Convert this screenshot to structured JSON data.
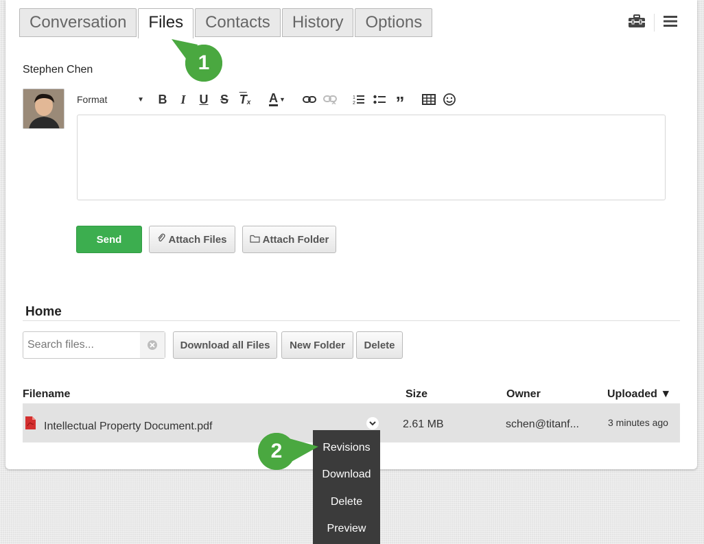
{
  "tabs": [
    {
      "label": "Conversation",
      "active": false
    },
    {
      "label": "Files",
      "active": true
    },
    {
      "label": "Contacts",
      "active": false
    },
    {
      "label": "History",
      "active": false
    },
    {
      "label": "Options",
      "active": false
    }
  ],
  "top_icons": [
    "toolbox-icon",
    "menu-icon"
  ],
  "user": {
    "name": "Stephen Chen"
  },
  "editor_toolbar": {
    "format_label": "Format",
    "buttons": [
      "bold",
      "italic",
      "underline",
      "strikethrough",
      "clear-formatting",
      "font-color",
      "link",
      "unlink",
      "numbered-list",
      "bulleted-list",
      "blockquote",
      "table",
      "emoji"
    ]
  },
  "actions": {
    "send_label": "Send",
    "attach_files_label": "Attach Files",
    "attach_folder_label": "Attach Folder"
  },
  "files": {
    "section_title": "Home",
    "search_placeholder": "Search files...",
    "download_all_label": "Download all Files",
    "new_folder_label": "New Folder",
    "delete_label": "Delete",
    "columns": {
      "filename": "Filename",
      "size": "Size",
      "owner": "Owner",
      "uploaded": "Uploaded ▼"
    },
    "rows": [
      {
        "filename": "Intellectual Property Document.pdf",
        "size": "2.61 MB",
        "owner": "schen@titanf...",
        "uploaded": "3 minutes ago"
      }
    ]
  },
  "row_menu": {
    "items": [
      "Revisions",
      "Download",
      "Delete",
      "Preview"
    ]
  },
  "callouts": [
    "1",
    "2"
  ],
  "colors": {
    "accent_green": "#3cae4f",
    "callout_green": "#4aa840",
    "pdf_red": "#d32f2f",
    "menu_bg": "#3b3b3b"
  }
}
